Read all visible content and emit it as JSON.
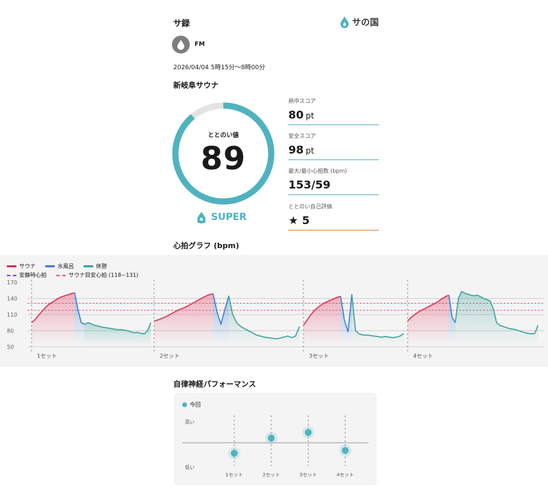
{
  "header": {
    "title": "サ録",
    "brand_label": "サの国",
    "user_name": "FM",
    "datetime": "2026/04/04 5時15分〜8時00分",
    "facility": "新岐阜サウナ"
  },
  "score": {
    "label": "ととのい値",
    "value": "89",
    "rank": "SUPER",
    "progress": 0.89,
    "ring_color": "#4fb3bf"
  },
  "stats": [
    {
      "label": "熱中スコア",
      "value": "80",
      "unit": "pt"
    },
    {
      "label": "安全スコア",
      "value": "98",
      "unit": "pt"
    },
    {
      "label": "最大/最小心拍数 (bpm)",
      "value": "153/59",
      "unit": ""
    },
    {
      "label": "ととのい自己評価",
      "value": "★ 5",
      "unit": ""
    }
  ],
  "hr_section": {
    "title": "心拍グラフ (bpm)",
    "legend": [
      {
        "label": "サウナ",
        "color": "#d6325a"
      },
      {
        "label": "水風呂",
        "color": "#3b82d6"
      },
      {
        "label": "休憩",
        "color": "#3fa39a"
      },
      {
        "label": "安静時心拍",
        "color": "#8a3fd6"
      },
      {
        "label": "サウナ目安心拍 (118~131)",
        "color": "#e85a7a"
      }
    ],
    "set_labels": [
      "1セット",
      "2セット",
      "3セット",
      "4セット"
    ]
  },
  "chart_data": {
    "type": "line",
    "y_ticks": [
      140,
      110,
      80,
      50
    ],
    "y_labels": [
      "170",
      "140",
      "110",
      "80",
      "50"
    ],
    "ylim": [
      50,
      170
    ],
    "target_band": [
      118,
      131
    ],
    "sets": [
      {
        "name": "1セット",
        "sauna": [
          95,
          100,
          108,
          115,
          122,
          128,
          132,
          136,
          140,
          143,
          145,
          147,
          149,
          151
        ],
        "cold": [
          151,
          120,
          95,
          92
        ],
        "rest": [
          92,
          95,
          93,
          90,
          89,
          87,
          86,
          85,
          84,
          83,
          82,
          82,
          81,
          80,
          78,
          76,
          77,
          75,
          74,
          80,
          95
        ]
      },
      {
        "name": "2セット",
        "sauna": [
          98,
          100,
          103,
          106,
          110,
          114,
          118,
          121,
          124,
          128,
          132,
          136,
          140,
          144,
          147,
          149
        ],
        "cold": [
          149,
          115,
          92,
          120,
          145
        ],
        "rest": [
          145,
          110,
          95,
          88,
          84,
          80,
          76,
          72,
          70,
          68,
          67,
          66,
          65,
          66,
          68,
          70,
          67,
          70,
          88
        ]
      },
      {
        "name": "3セット",
        "sauna": [
          90,
          100,
          110,
          118,
          124,
          129,
          133,
          136,
          139,
          142,
          144
        ],
        "cold": [
          144,
          100,
          78,
          148
        ],
        "rest": [
          148,
          80,
          74,
          72,
          72,
          71,
          70,
          69,
          68,
          69,
          68,
          67,
          68,
          70,
          75
        ]
      },
      {
        "name": "4セット",
        "sauna": [
          98,
          104,
          109,
          113,
          117,
          120,
          123,
          126,
          129,
          132,
          136,
          140,
          144,
          146
        ],
        "cold": [
          146,
          105,
          95
        ],
        "rest": [
          95,
          140,
          153,
          150,
          148,
          146,
          145,
          146,
          143,
          140,
          138,
          135,
          120,
          95,
          90,
          88,
          86,
          84,
          83,
          82,
          80,
          78,
          76,
          75,
          74,
          75,
          90
        ]
      }
    ]
  },
  "perf_section": {
    "title": "自律神経パフォーマンス",
    "legend_label": "今回",
    "y_high": "高い",
    "y_low": "低い",
    "categories": [
      "1セット",
      "2セット",
      "3セット",
      "4セット"
    ],
    "values": [
      0.35,
      0.62,
      0.72,
      0.4
    ],
    "dot_color": "#4fb3bf"
  }
}
